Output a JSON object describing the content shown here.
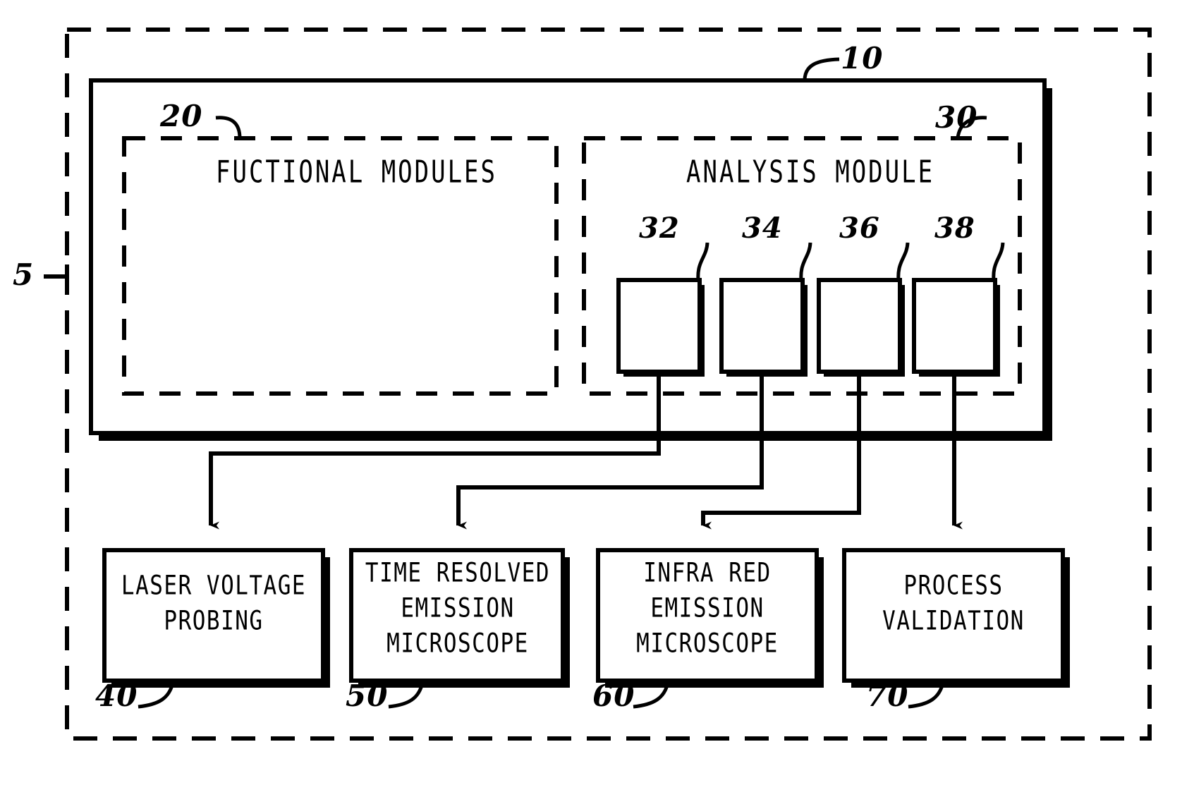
{
  "figure": {
    "outer_ref": "5",
    "system_ref": "10"
  },
  "sections": [
    {
      "ref": "20",
      "title": "FUCTIONAL MODULES"
    },
    {
      "ref": "30",
      "title": "ANALYSIS MODULE"
    }
  ],
  "analysis_units": [
    {
      "ref": "32"
    },
    {
      "ref": "34"
    },
    {
      "ref": "36"
    },
    {
      "ref": "38"
    }
  ],
  "output_boxes": [
    {
      "ref": "40",
      "lines": [
        "LASER VOLTAGE",
        "PROBING"
      ]
    },
    {
      "ref": "50",
      "lines": [
        "TIME RESOLVED",
        "EMISSION",
        "MICROSCOPE"
      ]
    },
    {
      "ref": "60",
      "lines": [
        "INFRA RED",
        "EMISSION",
        "MICROSCOPE"
      ]
    },
    {
      "ref": "70",
      "lines": [
        "PROCESS",
        "VALIDATION"
      ]
    }
  ],
  "style": {
    "ink": "#000000",
    "paper": "#ffffff"
  }
}
